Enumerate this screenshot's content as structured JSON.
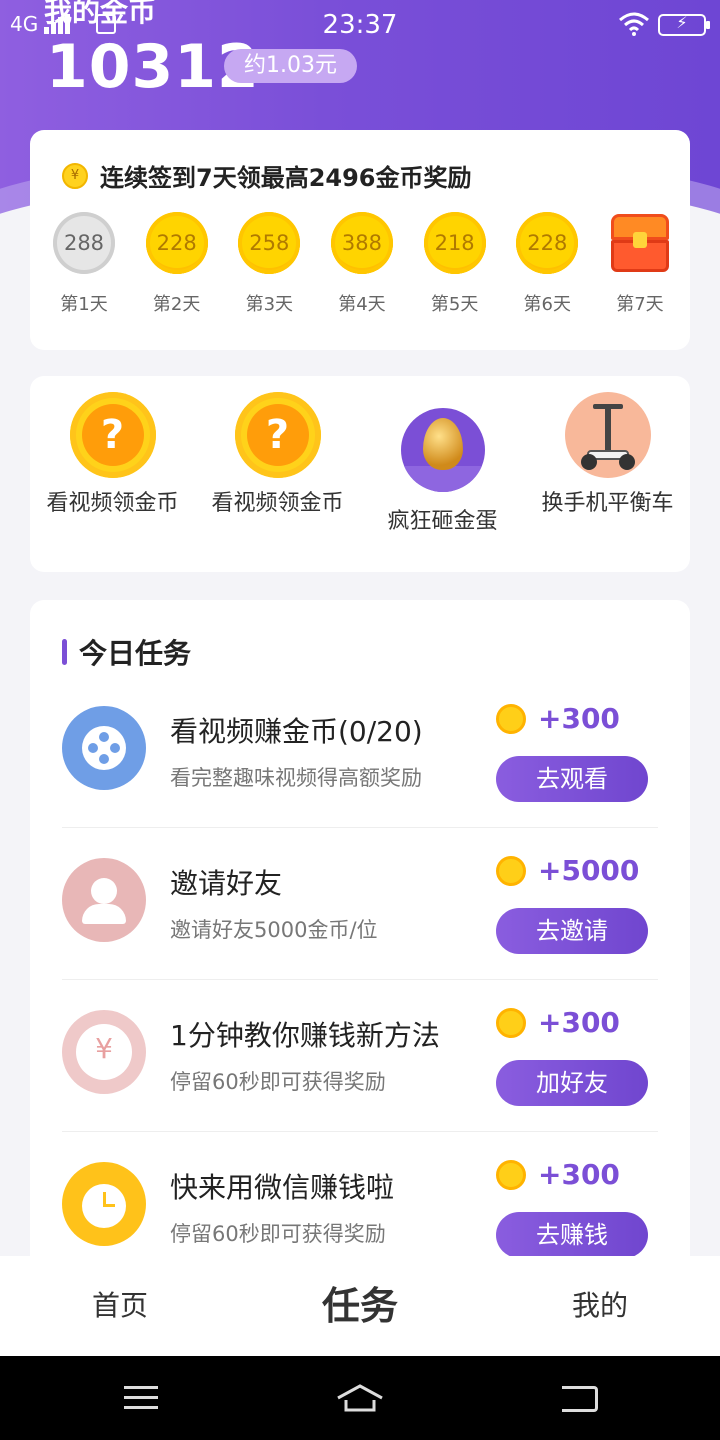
{
  "status_bar": {
    "network": "4G",
    "time": "23:37"
  },
  "header": {
    "title": "我的金币",
    "coins": "10312",
    "yuan": "约1.03元"
  },
  "signin": {
    "title": "连续签到7天领最高2496金币奖励",
    "days": [
      {
        "value": "288",
        "label": "第1天",
        "state": "checked"
      },
      {
        "value": "228",
        "label": "第2天"
      },
      {
        "value": "258",
        "label": "第3天"
      },
      {
        "value": "388",
        "label": "第4天"
      },
      {
        "value": "218",
        "label": "第5天"
      },
      {
        "value": "228",
        "label": "第6天"
      },
      {
        "value": "",
        "label": "第7天",
        "icon": "treasure-chest-icon"
      }
    ]
  },
  "quick_actions": [
    {
      "label": "看视频领金币",
      "icon": "question-coin-icon"
    },
    {
      "label": "看视频领金币",
      "icon": "question-coin-icon"
    },
    {
      "label": "疯狂砸金蛋",
      "icon": "golden-egg-icon"
    },
    {
      "label": "换手机平衡车",
      "icon": "balance-scooter-icon"
    }
  ],
  "tasks": {
    "title": "今日任务",
    "items": [
      {
        "name": "看视频赚金币(0/20)",
        "desc": "看完整趣味视频得高额奖励",
        "reward": "+300",
        "button": "去观看",
        "icon": "video-reel-icon"
      },
      {
        "name": "邀请好友",
        "desc": "邀请好友5000金币/位",
        "reward": "+5000",
        "button": "去邀请",
        "icon": "invite-user-icon"
      },
      {
        "name": "1分钟教你赚钱新方法",
        "desc": "停留60秒即可获得奖励",
        "reward": "+300",
        "button": "加好友",
        "icon": "yen-coin-icon"
      },
      {
        "name": "快来用微信赚钱啦",
        "desc": "停留60秒即可获得奖励",
        "reward": "+300",
        "button": "去赚钱",
        "icon": "alarm-clock-icon"
      }
    ]
  },
  "tab_bar": {
    "tabs": [
      "首页",
      "任务",
      "我的"
    ],
    "active": "任务"
  },
  "colors": {
    "accent": "#7b4fd6",
    "coin": "#ffd21a"
  }
}
